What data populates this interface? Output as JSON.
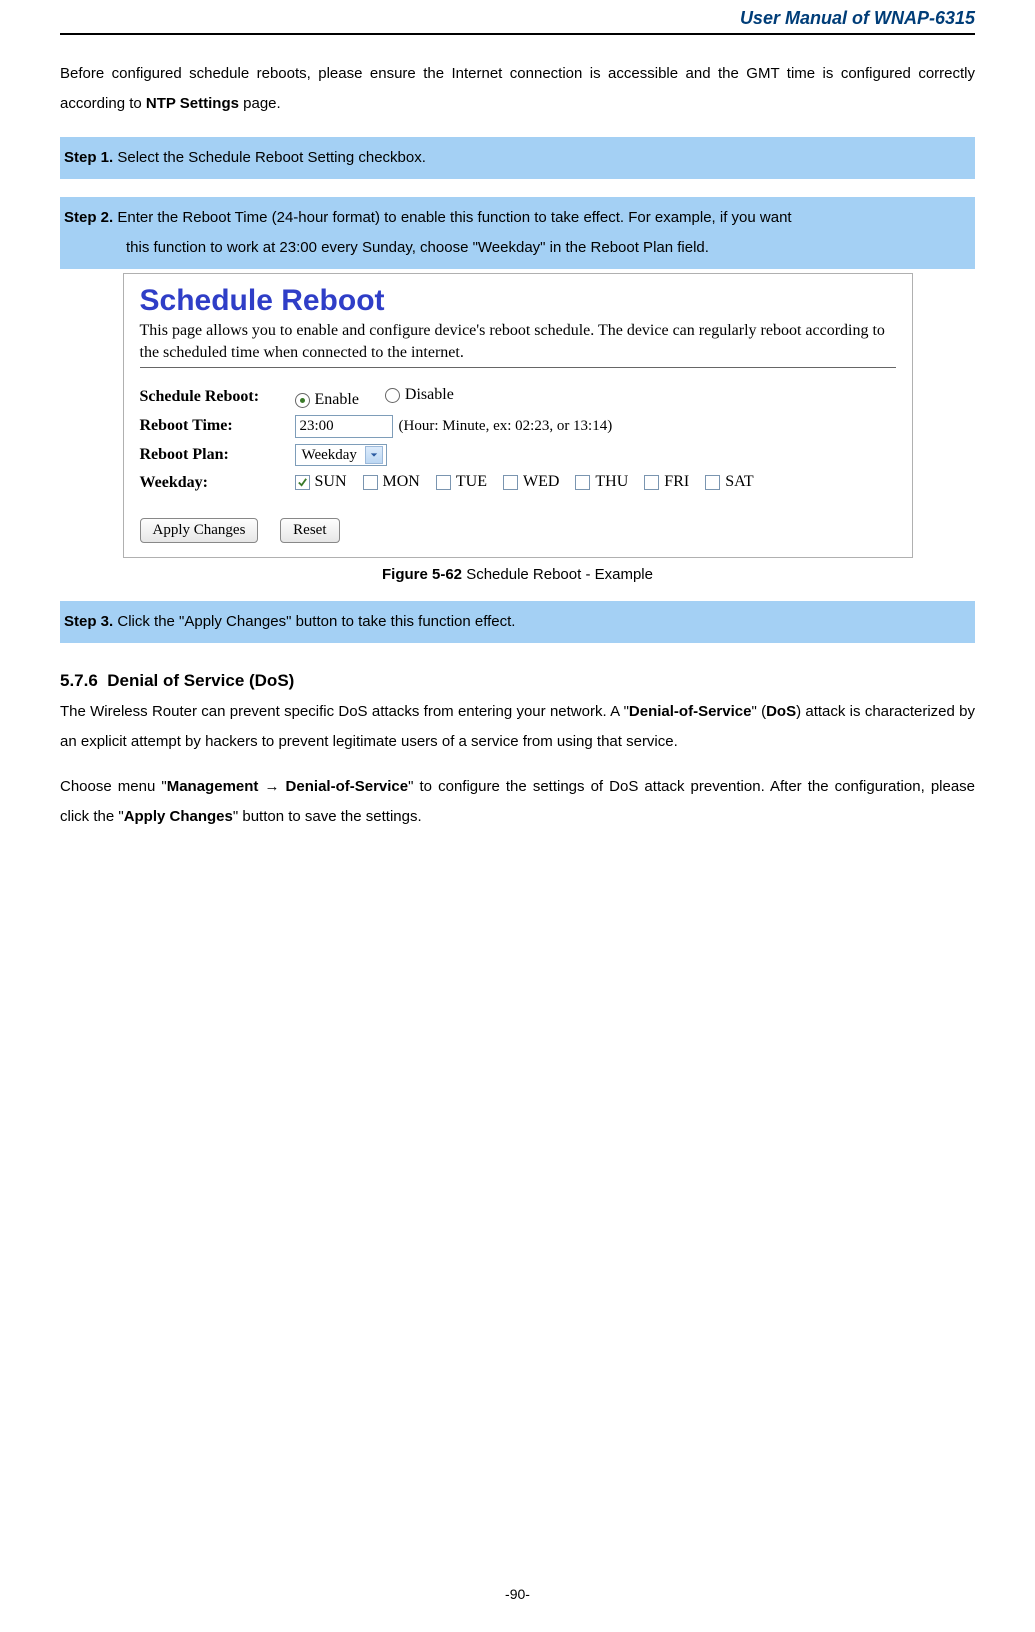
{
  "header": {
    "title": "User Manual of WNAP-6315"
  },
  "intro": {
    "text_a": "Before configured schedule reboots, please ensure the Internet connection is accessible and the GMT time is configured correctly according to ",
    "bold": "NTP Settings",
    "text_b": " page."
  },
  "steps": {
    "s1_label": "Step 1.",
    "s1_text": " Select the Schedule Reboot Setting checkbox.",
    "s2_label": "Step 2.",
    "s2_line1": " Enter the Reboot Time (24-hour format) to enable this function to take effect. For example, if you want",
    "s2_line2": "this function to work at 23:00 every Sunday, choose \"Weekday\" in the Reboot Plan field.",
    "s3_label": "Step 3.",
    "s3_text": " Click the \"Apply Changes\" button to take this function effect."
  },
  "panel": {
    "title": "Schedule Reboot",
    "desc": "This page allows you to enable and configure device's reboot schedule. The device can regularly reboot according to the scheduled time when connected to the internet.",
    "rows": {
      "schedule_label": "Schedule Reboot:",
      "enable": "Enable",
      "disable": "Disable",
      "reboot_time_label": "Reboot Time:",
      "reboot_time_value": "23:00",
      "reboot_time_hint": "(Hour: Minute, ex: 02:23, or 13:14)",
      "reboot_plan_label": "Reboot Plan:",
      "reboot_plan_value": "Weekday",
      "weekday_label": "Weekday:",
      "days": {
        "sun": "SUN",
        "mon": "MON",
        "tue": "TUE",
        "wed": "WED",
        "thu": "THU",
        "fri": "FRI",
        "sat": "SAT"
      },
      "apply": "Apply Changes",
      "reset": "Reset"
    }
  },
  "caption": {
    "bold": "Figure 5-62",
    "rest": " Schedule Reboot - Example"
  },
  "section": {
    "num": "5.7.6",
    "title": "Denial of Service (DoS)",
    "p1_a": "The Wireless Router can prevent specific DoS attacks from entering your network. A \"",
    "p1_b": "Denial-of-Service",
    "p1_c": "\" (",
    "p1_d": "DoS",
    "p1_e": ") attack is characterized by an explicit attempt by hackers to prevent legitimate users of a service from using that service.",
    "p2_a": "Choose menu \"",
    "p2_b": "Management → Denial-of-Service",
    "p2_c": "\" to configure the settings of DoS attack prevention. After the configuration, please click the \"",
    "p2_d": "Apply Changes",
    "p2_e": "\" button to save the settings."
  },
  "footer": {
    "page": "-90-"
  }
}
